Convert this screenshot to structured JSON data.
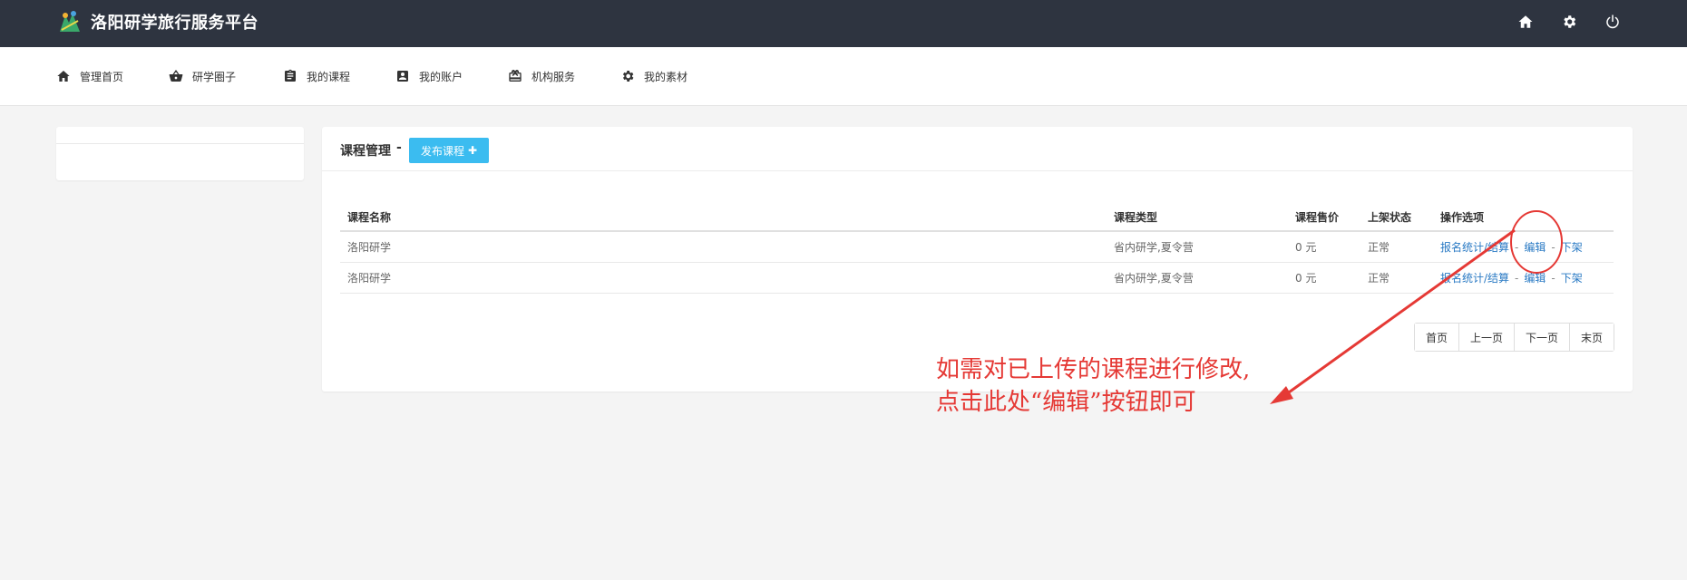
{
  "header": {
    "title": "洛阳研学旅行服务平台",
    "icons": [
      "home-icon",
      "gear-icon",
      "power-icon"
    ]
  },
  "nav": {
    "items": [
      {
        "label": "管理首页",
        "icon": "home-icon"
      },
      {
        "label": "研学圈子",
        "icon": "basket-icon"
      },
      {
        "label": "我的课程",
        "icon": "clipboard-icon"
      },
      {
        "label": "我的账户",
        "icon": "account-icon"
      },
      {
        "label": "机构服务",
        "icon": "gift-icon"
      },
      {
        "label": "我的素材",
        "icon": "gear-icon"
      }
    ]
  },
  "panel": {
    "title": "课程管理",
    "dash": "-",
    "publish_label": "发布课程",
    "publish_plus": "✚"
  },
  "table": {
    "headers": [
      "课程名称",
      "课程类型",
      "课程售价",
      "上架状态",
      "操作选项"
    ],
    "rows": [
      {
        "name": "洛阳研学",
        "type": "省内研学,夏令营",
        "price": "0 元",
        "status": "正常",
        "ops": [
          "报名统计/结算",
          "编辑",
          "下架"
        ]
      },
      {
        "name": "洛阳研学",
        "type": "省内研学,夏令营",
        "price": "0 元",
        "status": "正常",
        "ops": [
          "报名统计/结算",
          "编辑",
          "下架"
        ]
      }
    ],
    "op_sep": "-"
  },
  "pager": [
    "首页",
    "上一页",
    "下一页",
    "末页"
  ],
  "annotation": {
    "line1": "如需对已上传的课程进行修改,",
    "line2": "点击此处“编辑”按钮即可",
    "color": "#e53935"
  },
  "colors": {
    "topbar_bg": "#2e3440",
    "accent": "#3bbcf0",
    "link": "#2a7ac4"
  }
}
